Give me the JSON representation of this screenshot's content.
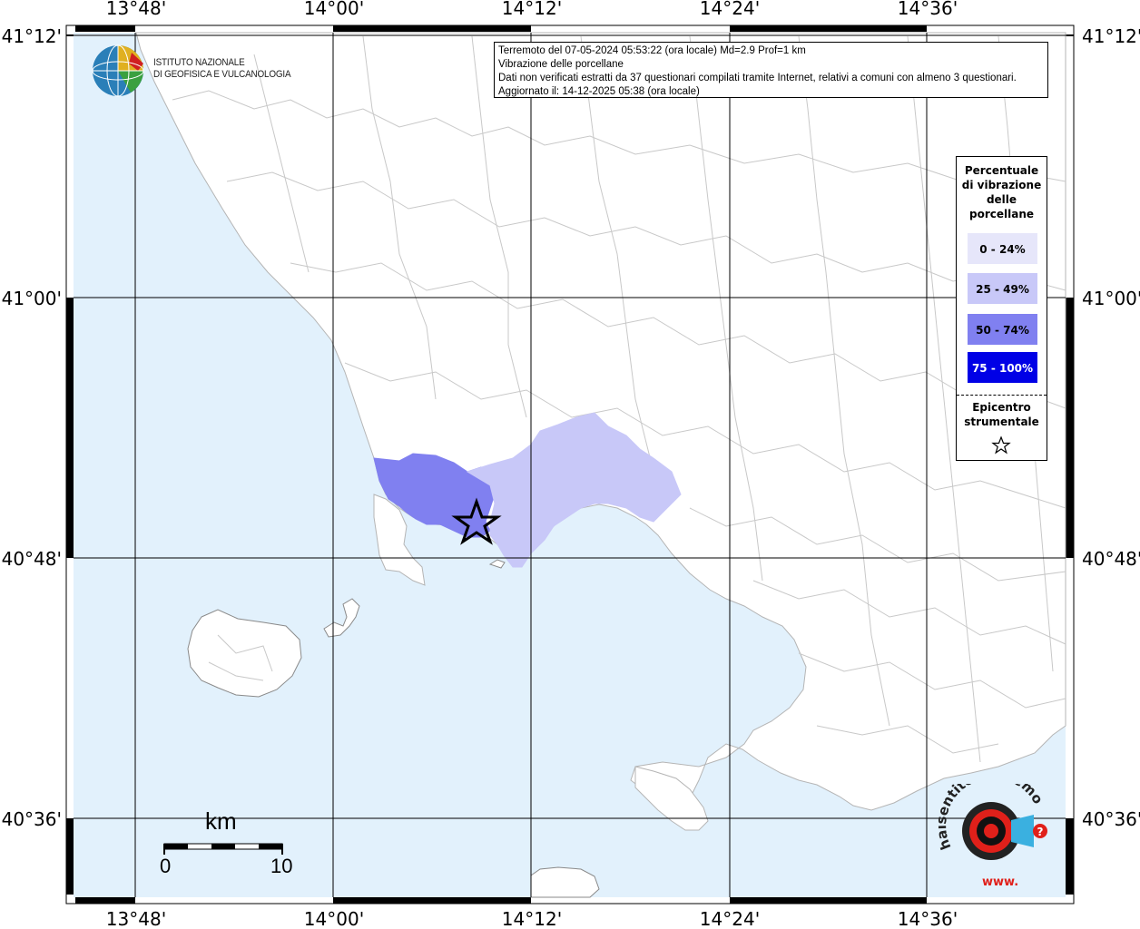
{
  "info": {
    "line1": "Terremoto del 07-05-2024 05:53:22 (ora locale) Md=2.9 Prof=1 km",
    "line2": "Vibrazione delle porcellane",
    "line3": "Dati non verificati estratti da 37 questionari compilati tramite Internet, relativi a comuni con almeno 3 questionari.",
    "line4": "Aggiornato il: 14-12-2025 05:38 (ora locale)"
  },
  "legend": {
    "title": [
      "Percentuale",
      "di vibrazione",
      "delle",
      "porcellane"
    ],
    "classes": [
      {
        "label": "0 - 24%",
        "color": "#e6e6fa",
        "text_color": "#000000"
      },
      {
        "label": "25 - 49%",
        "color": "#c8c8f8",
        "text_color": "#000000"
      },
      {
        "label": "50 - 74%",
        "color": "#8080f0",
        "text_color": "#000000"
      },
      {
        "label": "75 - 100%",
        "color": "#0000e6",
        "text_color": "#ffffff"
      }
    ],
    "epicenter": [
      "Epicentro",
      "strumentale"
    ]
  },
  "logo_ingv": {
    "text": [
      "ISTITUTO NAZIONALE",
      "DI GEOFISICA E VULCANOLOGIA"
    ]
  },
  "logo_hst": {
    "text": "haisentitoilterremoto.it",
    "www": "www."
  },
  "axes": {
    "lon_labels": [
      "13°48'",
      "14°00'",
      "14°12'",
      "14°24'",
      "14°36'"
    ],
    "lat_labels": [
      "41°12'",
      "41°00'",
      "40°48'",
      "40°36'"
    ]
  },
  "scale_bar": {
    "unit": "km",
    "min": "0",
    "max": "10"
  },
  "colors": {
    "sea": "#e2f1fc",
    "land": "#ffffff",
    "border": "#c8c8c8",
    "grid": "#000000"
  }
}
